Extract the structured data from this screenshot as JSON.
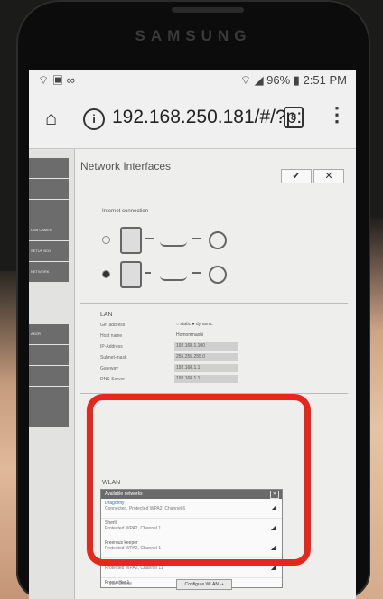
{
  "phone": {
    "brand": "SAMSUNG",
    "status_left": "⌔ ▣ ∞",
    "status_right": "⌔ ◢ 96% ▮ 2:51 PM"
  },
  "browser": {
    "home_icon": "home-icon",
    "info_icon": "info-icon",
    "url": "192.168.250.181/#/?p:",
    "tab_count": "8",
    "menu_icon": "more-vert-icon"
  },
  "sidebar": {
    "items": [
      "",
      "",
      "",
      "USB CAMER",
      "SETUP BOX",
      "NETWORK",
      "",
      "",
      "AKER",
      "",
      "",
      "",
      ""
    ]
  },
  "panel": {
    "title": "Network Interfaces",
    "ok_label": "✔",
    "close_label": "✕",
    "internet_label": "Internet connection"
  },
  "lan": {
    "title": "LAN",
    "rows": [
      {
        "label": "Get address",
        "value": "○ static ● dynamic"
      },
      {
        "label": "Host name",
        "value": "Homorrmaobi"
      },
      {
        "label": "IP-Address",
        "value": "192.168.1.100"
      },
      {
        "label": "Subnet-mask",
        "value": "255.255.255.0"
      },
      {
        "label": "Gateway",
        "value": "192.168.1.1"
      },
      {
        "label": "DNS-Server",
        "value": "192.168.1.1"
      }
    ]
  },
  "wlan": {
    "title": "WLAN",
    "list_header": "Available networks",
    "networks": [
      {
        "name": "Dragonfly",
        "desc": "Connected, Protected WPA2, Channel 6"
      },
      {
        "name": "Sherlil",
        "desc": "Protected WPA2, Channel 1"
      },
      {
        "name": "Freerous keeper",
        "desc": "Protected WPA2, Channel 1"
      },
      {
        "name": "Freouse",
        "desc": "Protected WPA2, Channel 11"
      },
      {
        "name": "Freouslike 1",
        "desc": ""
      }
    ],
    "buttons": "Join    Delete",
    "configure_label": "Configure WLAN ⇢"
  },
  "colors": {
    "highlight": "#e8261b",
    "sidebar": "#6c6c6c"
  }
}
